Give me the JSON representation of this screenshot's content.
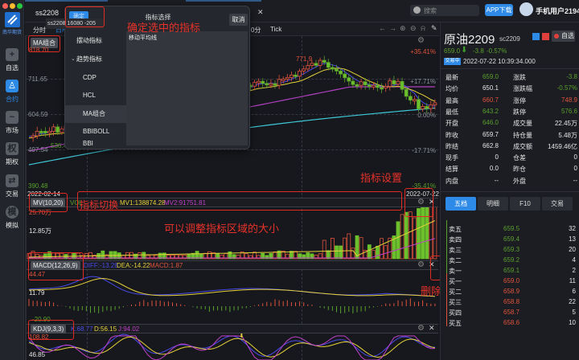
{
  "window": {
    "traffic_lights": [
      "#fe5f57",
      "#febc2e",
      "#28c840"
    ]
  },
  "sidebar": {
    "logo_text": "南华期货",
    "items": [
      {
        "label": "自选",
        "icon": "plus-icon",
        "active": false
      },
      {
        "label": "合约",
        "icon": "contract-icon",
        "active": true
      },
      {
        "label": "市场",
        "icon": "market-trend-icon",
        "active": false
      },
      {
        "label": "期权",
        "icon": "option-icon",
        "active": false
      },
      {
        "label": "交易",
        "icon": "trade-icon",
        "active": false
      },
      {
        "label": "模拟",
        "icon": "simulate-icon",
        "active": false
      }
    ]
  },
  "topbar": {
    "tab_label": "ss2208",
    "tooltip": {
      "code": "ss2208",
      "price": "16080",
      "change": "-205"
    },
    "search_placeholder": "搜索",
    "app_download": "APP下载",
    "username": "手机用户2194"
  },
  "toolbar": {
    "periods": [
      "分时",
      "日K",
      "0分",
      "Tick"
    ],
    "icons": [
      "arrow-left-icon",
      "arrow-right-icon",
      "zoom-in-icon",
      "zoom-out-icon",
      "bell-icon",
      "pen-icon"
    ]
  },
  "main_chart": {
    "indicator": "MA组合",
    "left_labels": [
      "818.70",
      "711.65",
      "604.59",
      "497.54",
      "390.48"
    ],
    "right_labels": [
      "+35.41%",
      "+17.71%",
      "0.00%",
      "-17.71%",
      "-35.41%"
    ],
    "high_marker": "771.9",
    "low_marker": "536.4",
    "start_date": "2022-02-14",
    "end_date": "2022-07-22"
  },
  "mv_pane": {
    "indicator": "MV(10,20)",
    "vol_label": "VOL",
    "mv1": "MV1:138874.28",
    "mv2": "MV2:91751.81",
    "max_label": "25.70万",
    "mid_label": "12.85万"
  },
  "macd_pane": {
    "indicator": "MACD(12,26,9)",
    "diff": "DIFF:-13.28",
    "dea": "DEA:-14.22",
    "macd": "MACD:1.87",
    "max_label": "44.47",
    "mid_label": "11.79",
    "min_label": "-20.90"
  },
  "kdj_pane": {
    "indicator": "KDJ(9,3,3)",
    "k": "K:68.77",
    "d": "D:56.15",
    "j": "J:94.02",
    "max_label": "108.82",
    "mid_label": "46.85"
  },
  "popup": {
    "title": "指标选择",
    "confirm": "确定",
    "cancel": "取消",
    "categories": [
      {
        "label": "摆动指标",
        "type": "category"
      },
      {
        "label": "趋势指标",
        "type": "category-open"
      },
      {
        "label": "CDP",
        "type": "item"
      },
      {
        "label": "HCL",
        "type": "item"
      },
      {
        "label": "MA组合",
        "type": "item",
        "selected": true
      },
      {
        "label": "BBIBOLL",
        "type": "item"
      },
      {
        "label": "BBI",
        "type": "item"
      }
    ],
    "description": "移动平均线"
  },
  "annotations": {
    "confirm": "确定选中的指标",
    "switch": "指标切换",
    "resize": "可以调整指标区域的大小",
    "settings": "指标设置",
    "delete": "删除指标"
  },
  "quote": {
    "name": "原油2209",
    "code": "sc2209",
    "watch_button": "自选",
    "price": "659.0",
    "change": "-3.8",
    "change_pct": "-0.57%",
    "status": "交易中",
    "timestamp": "2022-07-22 10:39:34.000",
    "stats": [
      {
        "l1": "最新",
        "v1": "659.0",
        "c1": "green",
        "l2": "涨跌",
        "v2": "-3.8",
        "c2": "green"
      },
      {
        "l1": "均价",
        "v1": "650.1",
        "c1": "white",
        "l2": "涨跌幅",
        "v2": "-0.57%",
        "c2": "green"
      },
      {
        "l1": "最高",
        "v1": "660.7",
        "c1": "red",
        "l2": "涨停",
        "v2": "748.9",
        "c2": "red"
      },
      {
        "l1": "最低",
        "v1": "643.2",
        "c1": "green",
        "l2": "跌停",
        "v2": "576.6",
        "c2": "green"
      },
      {
        "l1": "开盘",
        "v1": "646.0",
        "c1": "green",
        "l2": "成交量",
        "v2": "22.45万",
        "c2": "white"
      },
      {
        "l1": "昨收",
        "v1": "659.7",
        "c1": "white",
        "l2": "持仓量",
        "v2": "5.48万",
        "c2": "white"
      },
      {
        "l1": "昨结",
        "v1": "662.8",
        "c1": "white",
        "l2": "成交额",
        "v2": "1459.46亿",
        "c2": "white"
      },
      {
        "l1": "现手",
        "v1": "0",
        "c1": "white",
        "l2": "仓差",
        "v2": "0",
        "c2": "white"
      },
      {
        "l1": "结算",
        "v1": "0.0",
        "c1": "white",
        "l2": "昨仓",
        "v2": "0",
        "c2": "white"
      },
      {
        "l1": "内盘",
        "v1": "--",
        "c1": "white",
        "l2": "外盘",
        "v2": "--",
        "c2": "white"
      }
    ],
    "tabs": [
      "五档",
      "明细",
      "F10",
      "交易"
    ],
    "active_tab": "五档",
    "order_book": [
      {
        "label": "卖五",
        "price": "659.5",
        "vol": "32",
        "c": "green"
      },
      {
        "label": "卖四",
        "price": "659.4",
        "vol": "13",
        "c": "green"
      },
      {
        "label": "卖三",
        "price": "659.3",
        "vol": "20",
        "c": "green"
      },
      {
        "label": "卖二",
        "price": "659.2",
        "vol": "4",
        "c": "green"
      },
      {
        "label": "卖一",
        "price": "659.1",
        "vol": "2",
        "c": "green"
      },
      {
        "label": "买一",
        "price": "659.0",
        "vol": "11",
        "c": "red"
      },
      {
        "label": "买二",
        "price": "658.9",
        "vol": "6",
        "c": "red"
      },
      {
        "label": "买三",
        "price": "658.8",
        "vol": "22",
        "c": "red"
      },
      {
        "label": "买四",
        "price": "658.7",
        "vol": "5",
        "c": "red"
      },
      {
        "label": "买五",
        "price": "658.6",
        "vol": "10",
        "c": "red"
      }
    ]
  },
  "colors": {
    "up": "#e0533c",
    "down": "#5aa02c",
    "accent": "#2d8ae6",
    "annotation": "#e02a22"
  }
}
